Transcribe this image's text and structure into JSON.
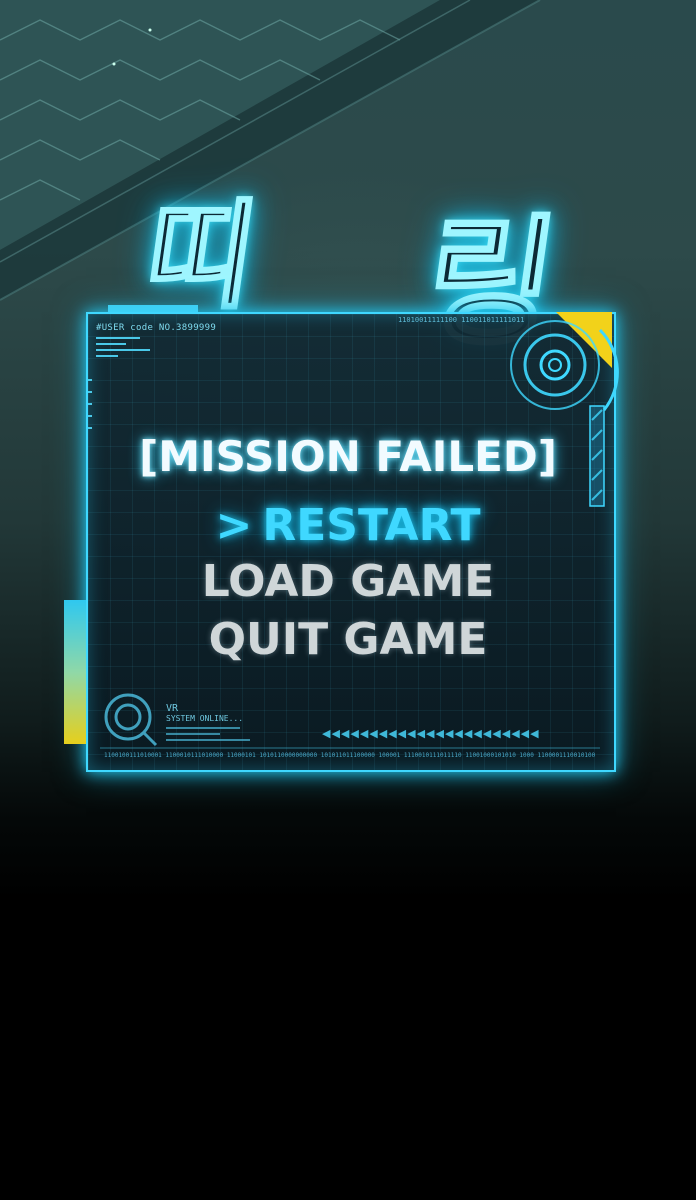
{
  "sfx": {
    "part1": "띠",
    "part2": "링"
  },
  "hud": {
    "user_code": "#USER code NO.3899999",
    "binary_top": "11010011111100 110011011111011",
    "binary_bottom": "1100100111010001 1100010111010000 11000101 1010110000000000 101011011100000 100001 1110010111011110 11001000101010 1000 1100001110010100",
    "vr_label": "VR",
    "system_status": "SYSTEM ONLINE...",
    "triangles": "◀◀◀◀◀◀◀◀◀◀◀◀◀◀◀◀◀◀◀◀◀◀◀"
  },
  "dialog": {
    "title": "[MISSION FAILED]",
    "cursor": ">",
    "options": [
      "RESTART",
      "LOAD GAME",
      "QUIT GAME"
    ],
    "selected": "RESTART"
  },
  "colors": {
    "glow_cyan": "#3fd8ff",
    "accent_yellow": "#f2d21a",
    "panel_bg": "#12303a"
  },
  "icons": [
    "target-reticle-icon",
    "vr-scope-icon",
    "corner-ring-icon"
  ]
}
